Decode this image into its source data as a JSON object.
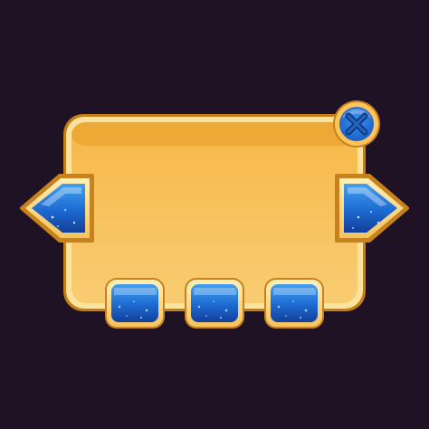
{
  "scene": {
    "type": "game-ui-popup-panel",
    "background_color": "#1f1224"
  },
  "panel": {
    "fill_top": "#f6b848",
    "fill_bottom": "#f9cc73",
    "border_color": "#fbe39e",
    "border_outer_color": "#c77d16",
    "top_strip_color": "#e89a24"
  },
  "buttons": {
    "blue_light": "#43a0f0",
    "blue_mid": "#1d6ad2",
    "blue_dark": "#123f9a",
    "frame_color": "#fcd98a",
    "frame_outer_color": "#c7821d",
    "sparkle_color": "#bfe2ff"
  },
  "close_button": {
    "icon": "close-x-icon",
    "ring_color": "#ffc55a",
    "fill_color": "#2a7ae0",
    "x_color": "#0e3b86"
  },
  "nav_arrows": {
    "left_icon": "arrow-left-icon",
    "right_icon": "arrow-right-icon"
  },
  "bottom_buttons": [
    {
      "id": "slot-1"
    },
    {
      "id": "slot-2"
    },
    {
      "id": "slot-3"
    }
  ]
}
